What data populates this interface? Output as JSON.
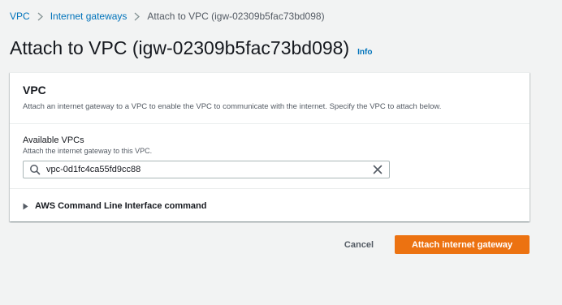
{
  "breadcrumb": {
    "items": [
      "VPC",
      "Internet gateways"
    ],
    "current": "Attach to VPC (igw-02309b5fac73bd098)"
  },
  "header": {
    "title": "Attach to VPC (igw-02309b5fac73bd098)",
    "info": "Info"
  },
  "panel": {
    "title": "VPC",
    "description": "Attach an internet gateway to a VPC to enable the VPC to communicate with the internet. Specify the VPC to attach below.",
    "field": {
      "label": "Available VPCs",
      "description": "Attach the internet gateway to this VPC.",
      "value": "vpc-0d1fc4ca55fd9cc88"
    },
    "expander_label": "AWS Command Line Interface command"
  },
  "actions": {
    "cancel": "Cancel",
    "submit": "Attach internet gateway"
  },
  "icons": {
    "separator": "chevron-right-icon",
    "search": "search-icon",
    "clear": "close-icon",
    "expander": "caret-right-icon"
  },
  "colors": {
    "link": "#0073bb",
    "primary": "#ec7211",
    "background": "#f2f3f3"
  }
}
